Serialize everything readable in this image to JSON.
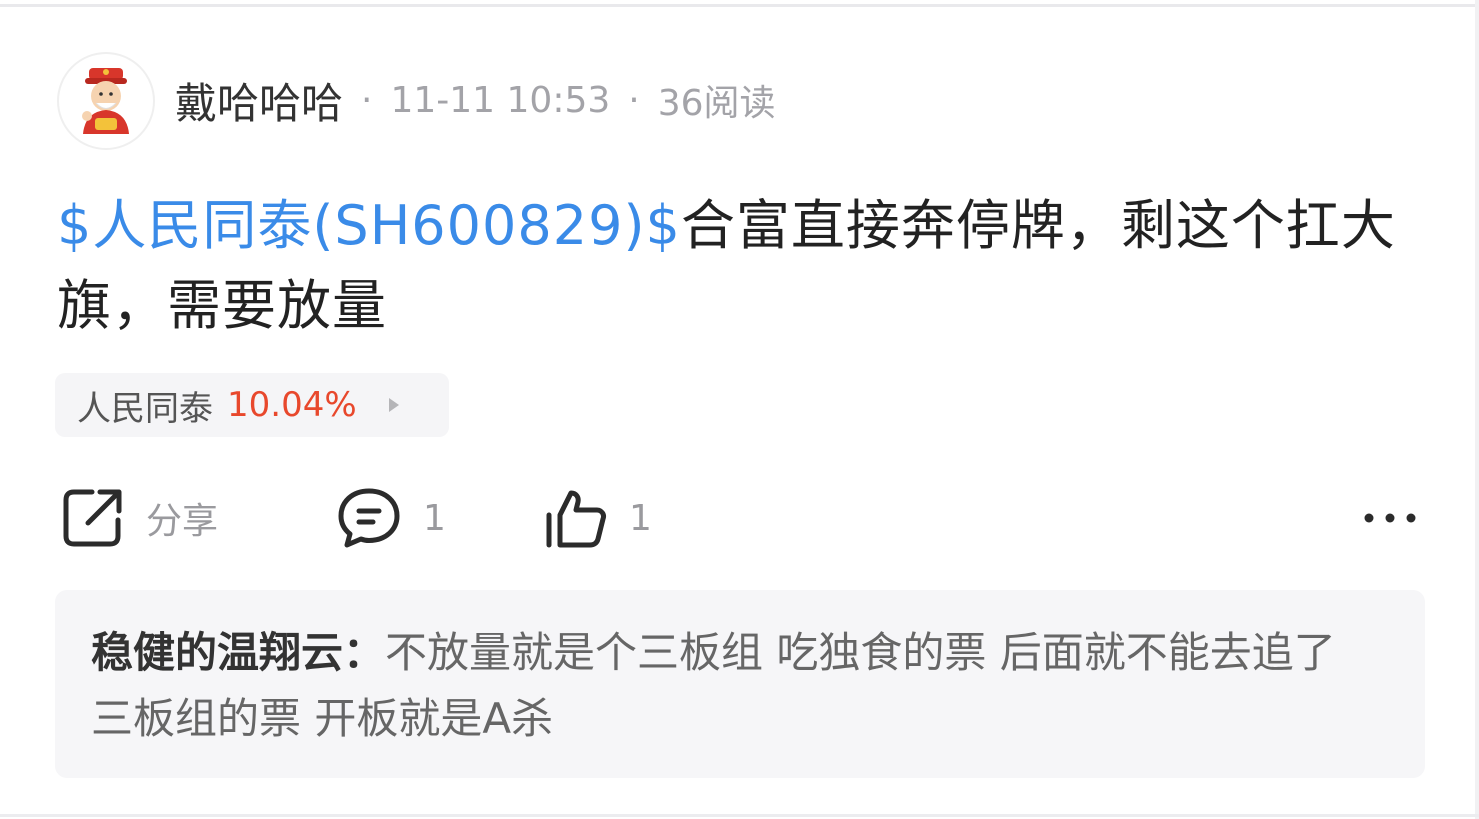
{
  "post": {
    "author": "戴哈哈哈",
    "date": "11-11 10:53",
    "reads": "36阅读",
    "separator": "·",
    "stock_link": "$人民同泰(SH600829)$",
    "body": "合富直接奔停牌，剩这个扛大旗，需要放量"
  },
  "stock_chip": {
    "name": "人民同泰",
    "change": "10.04%"
  },
  "actions": {
    "share_label": "分享",
    "comment_count": "1",
    "like_count": "1"
  },
  "comment": {
    "author": "稳健的温翔云：",
    "text": "不放量就是个三板组 吃独食的票 后面就不能去追了 三板组的票 开板就是A杀"
  },
  "icons": {
    "avatar": "god-of-wealth-avatar",
    "share": "share-icon",
    "comment": "comment-bubble-icon",
    "like": "thumbs-up-icon",
    "more": "more-dots-icon",
    "chip_arrow": "caret-right-icon"
  },
  "colors": {
    "link": "#3a8be8",
    "gain": "#e8482c",
    "meta": "#a3a3a8",
    "card_bg": "#f6f6f8"
  }
}
